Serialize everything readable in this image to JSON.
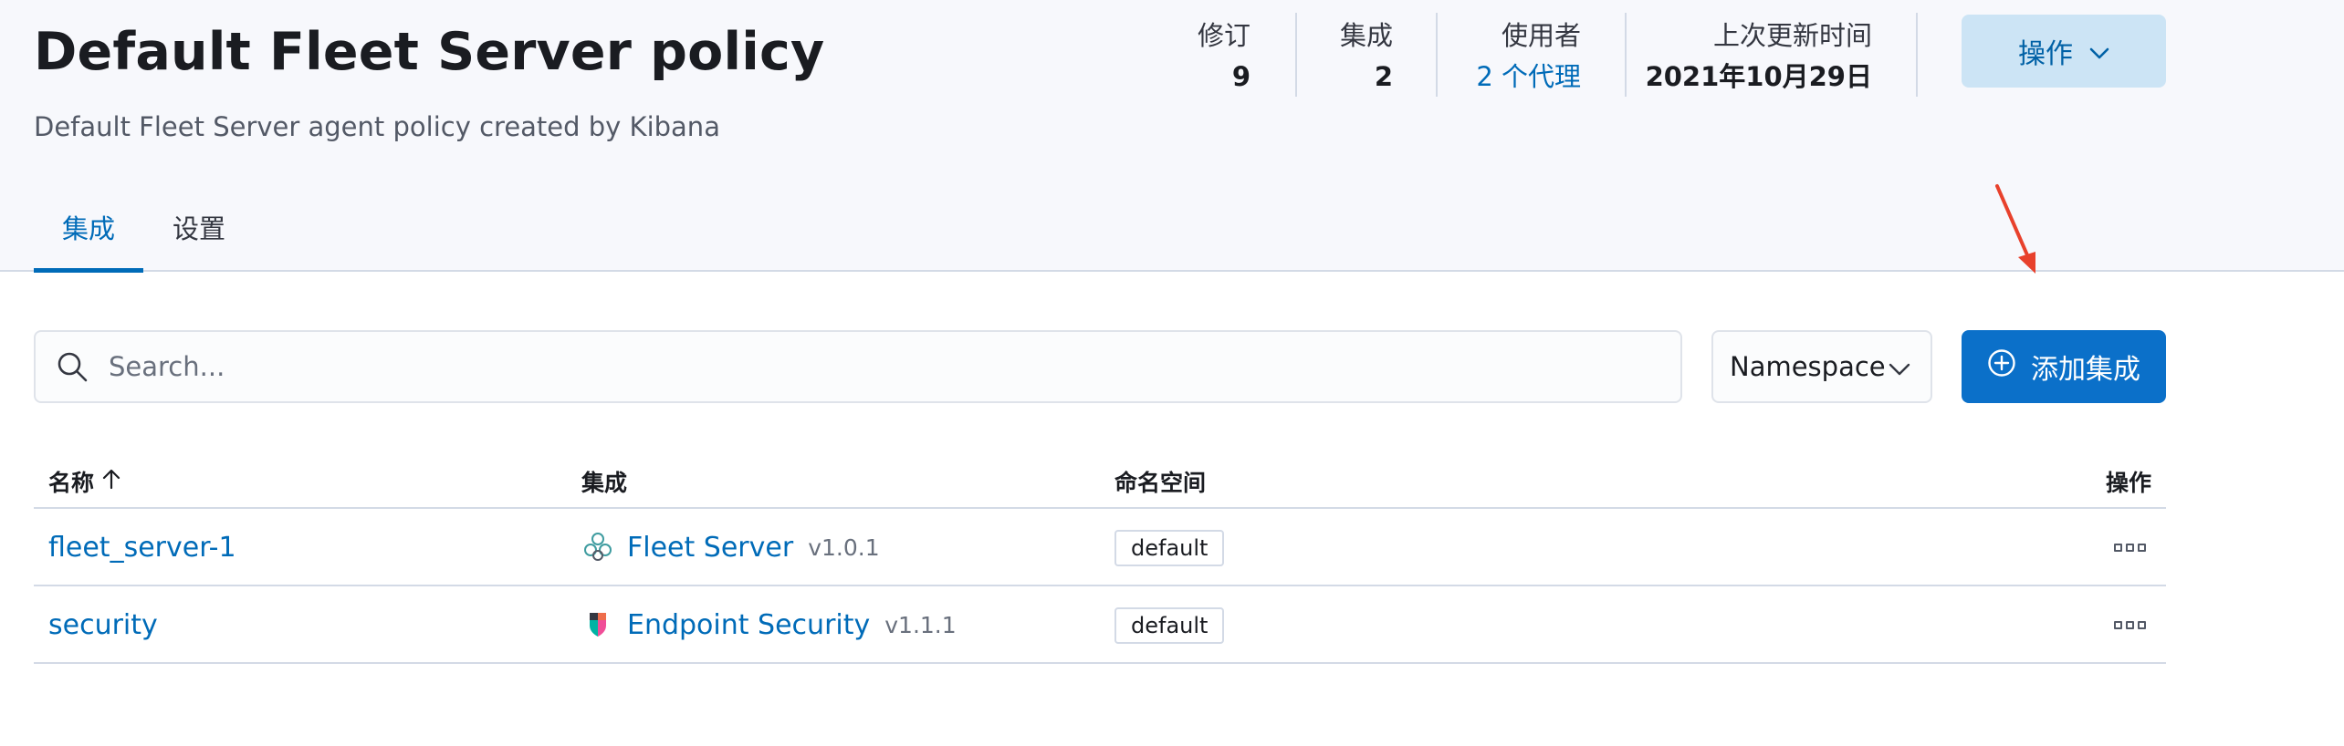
{
  "header": {
    "title": "Default Fleet Server policy",
    "description": "Default Fleet Server agent policy created by Kibana",
    "stats": {
      "revision_label": "修订",
      "revision_value": "9",
      "integrations_label": "集成",
      "integrations_value": "2",
      "used_by_label": "使用者",
      "used_by_value": "2 个代理",
      "last_updated_label": "上次更新时间",
      "last_updated_value": "2021年10月29日"
    },
    "actions_label": "操作"
  },
  "tabs": [
    {
      "label": "集成",
      "active": true
    },
    {
      "label": "设置",
      "active": false
    }
  ],
  "toolbar": {
    "search_placeholder": "Search...",
    "namespace_label": "Namespace",
    "add_integration_label": "添加集成"
  },
  "table": {
    "headers": {
      "name": "名称",
      "integration": "集成",
      "namespace": "命名空间",
      "actions": "操作"
    },
    "rows": [
      {
        "name": "fleet_server-1",
        "integration": "Fleet Server",
        "version": "v1.0.1",
        "namespace": "default",
        "icon": "fleet-server-icon"
      },
      {
        "name": "security",
        "integration": "Endpoint Security",
        "version": "v1.1.1",
        "namespace": "default",
        "icon": "endpoint-security-icon"
      }
    ]
  },
  "colors": {
    "primary": "#0b70c9",
    "link": "#006bb8",
    "header_bg": "#f7f8fc",
    "annotation_arrow": "#e8412c"
  }
}
